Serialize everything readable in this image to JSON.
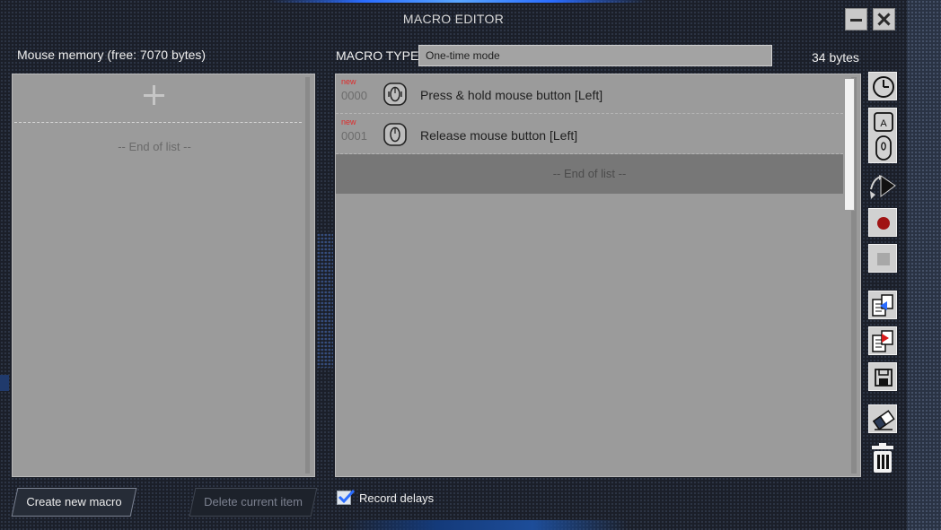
{
  "window": {
    "title": "MACRO EDITOR"
  },
  "left": {
    "memory_label": "Mouse memory (free: 7070 bytes)",
    "end_of_list": "-- End of list --"
  },
  "header": {
    "macro_type_label": "MACRO TYPE",
    "macro_type_value": "One-time mode",
    "bytes": "34 bytes"
  },
  "macro_list": {
    "items": [
      {
        "badge": "new",
        "index": "0000",
        "icon": "mouse-press-icon",
        "text": "Press & hold mouse button [Left]"
      },
      {
        "badge": "new",
        "index": "0001",
        "icon": "mouse-release-icon",
        "text": "Release mouse button [Left]"
      }
    ],
    "end_of_list": "-- End of list --"
  },
  "toolbar": {
    "tools": [
      "clock-icon",
      "keyboard-mouse-icon",
      "cursor-move-icon",
      "record-icon",
      "stop-icon",
      "import-icon",
      "export-icon",
      "save-icon",
      "eraser-icon",
      "trash-icon"
    ]
  },
  "footer": {
    "create_label": "Create new macro",
    "delete_label": "Delete current item",
    "record_delays_label": "Record delays",
    "record_delays_checked": true
  },
  "colors": {
    "badge_new": "#e02a2a",
    "record_dot": "#a01414",
    "accent_blue": "#2a6cff"
  }
}
